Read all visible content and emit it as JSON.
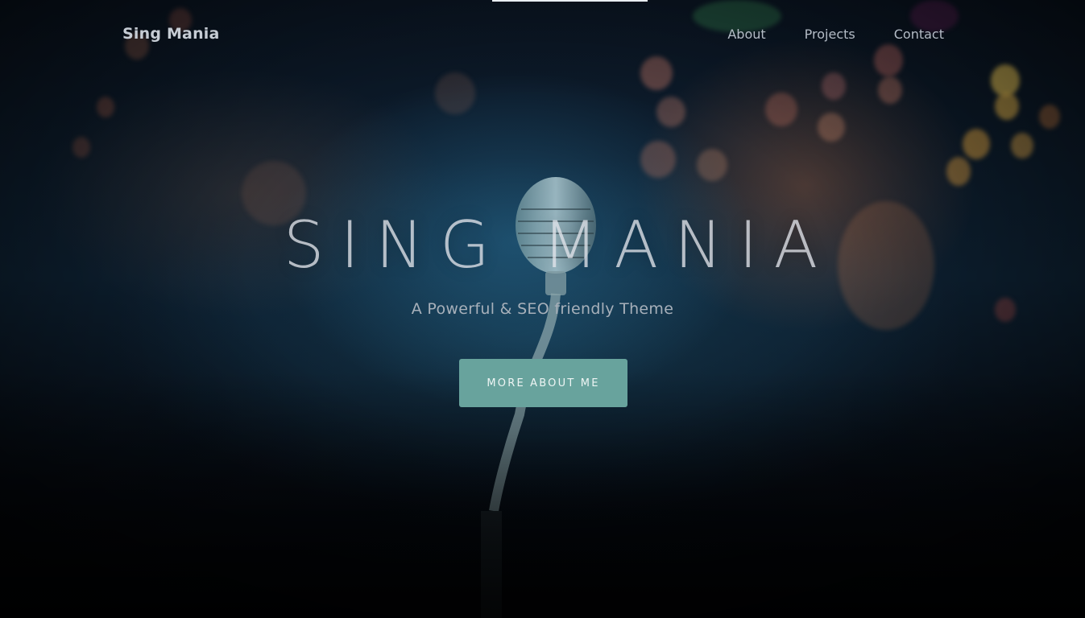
{
  "header": {
    "brand": "Sing Mania",
    "nav": [
      {
        "label": "About"
      },
      {
        "label": "Projects"
      },
      {
        "label": "Contact"
      }
    ]
  },
  "hero": {
    "title": "SING MANIA",
    "subtitle": "A Powerful & SEO friendly Theme",
    "cta_label": "MORE ABOUT ME",
    "background_image": "blurred-concert-stage-with-vintage-microphone"
  },
  "colors": {
    "accent": "#68a39d",
    "nav_text": "#b4bcc6",
    "title_text": "#e1e4eb"
  }
}
